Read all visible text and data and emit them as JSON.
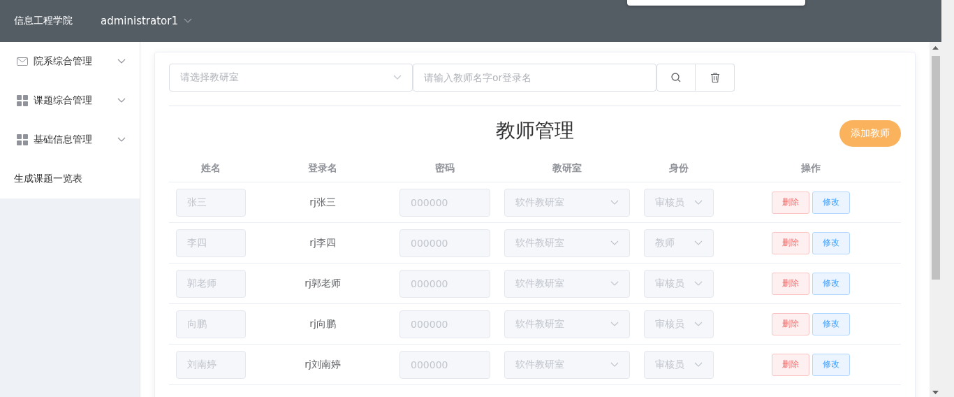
{
  "header": {
    "brand": "信息工程学院",
    "user": "administrator1"
  },
  "sidebar": {
    "items": [
      {
        "label": "院系综合管理",
        "kind": "mail",
        "expandable": true
      },
      {
        "label": "课题综合管理",
        "kind": "grid",
        "expandable": true
      },
      {
        "label": "基础信息管理",
        "kind": "grid",
        "expandable": true
      },
      {
        "label": "生成课题一览表",
        "kind": "plain",
        "expandable": false
      }
    ]
  },
  "filters": {
    "office_placeholder": "请选择教研室",
    "search_placeholder": "请输入教师名字or登录名"
  },
  "title": "教师管理",
  "add_button": "添加教师",
  "table": {
    "columns": [
      "姓名",
      "登录名",
      "密码",
      "教研室",
      "身份",
      "操作"
    ],
    "rows": [
      {
        "name": "张三",
        "login": "rj张三",
        "password": "000000",
        "office": "软件教研室",
        "role": "审核员",
        "delete": "删除",
        "edit": "修改"
      },
      {
        "name": "李四",
        "login": "rj李四",
        "password": "000000",
        "office": "软件教研室",
        "role": "教师",
        "delete": "删除",
        "edit": "修改"
      },
      {
        "name": "郭老师",
        "login": "rj郭老师",
        "password": "000000",
        "office": "软件教研室",
        "role": "审核员",
        "delete": "删除",
        "edit": "修改"
      },
      {
        "name": "向鹏",
        "login": "rj向鹏",
        "password": "000000",
        "office": "软件教研室",
        "role": "审核员",
        "delete": "删除",
        "edit": "修改"
      },
      {
        "name": "刘南婷",
        "login": "rj刘南婷",
        "password": "000000",
        "office": "软件教研室",
        "role": "审核员",
        "delete": "删除",
        "edit": "修改"
      }
    ]
  }
}
